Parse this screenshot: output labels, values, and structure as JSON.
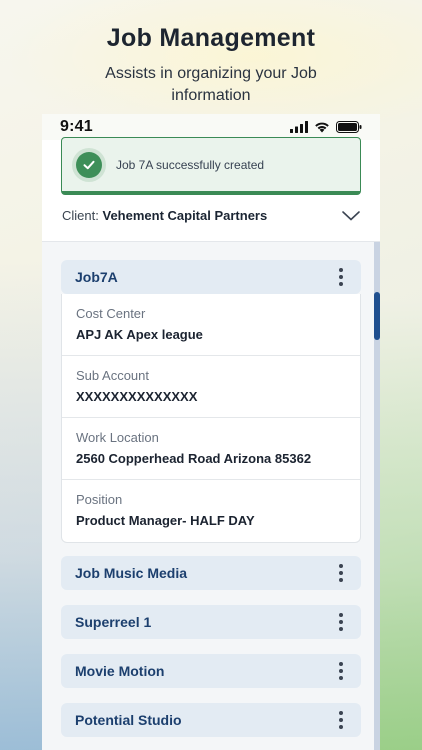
{
  "header": {
    "title": "Job Management",
    "subtitle_line1": "Assists in organizing your Job",
    "subtitle_line2": "information"
  },
  "status_bar": {
    "time": "9:41"
  },
  "toast": {
    "message": "Job 7A successfully created",
    "icon": "check-circle-icon"
  },
  "client": {
    "label": "Client:",
    "name": "Vehement Capital Partners"
  },
  "jobs": [
    {
      "title": "Job7A",
      "expanded": true,
      "details": [
        {
          "label": "Cost Center",
          "value": "APJ AK Apex league"
        },
        {
          "label": "Sub Account",
          "value": "XXXXXXXXXXXXXX"
        },
        {
          "label": "Work Location",
          "value": "2560 Copperhead Road Arizona 85362"
        },
        {
          "label": "Position",
          "value": "Product Manager- HALF DAY"
        }
      ]
    },
    {
      "title": "Job Music Media",
      "expanded": false
    },
    {
      "title": "Superreel 1",
      "expanded": false
    },
    {
      "title": "Movie Motion",
      "expanded": false
    },
    {
      "title": "Potential Studio",
      "expanded": false
    }
  ],
  "colors": {
    "accent": "#1c3f6e",
    "success": "#3a8a55",
    "job_header_bg": "#e3ebf3"
  }
}
